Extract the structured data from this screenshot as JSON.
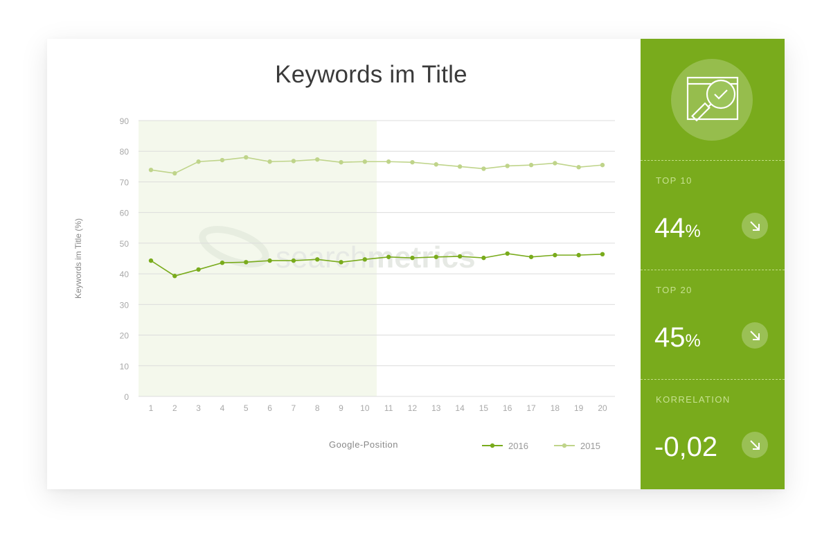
{
  "panel": {
    "brand_watermark": "searchmetrics",
    "icon": "magnifier-check-icon",
    "trend_icon": "arrow-down-right-icon",
    "accent_color": "#79ab1c",
    "stats": [
      {
        "label": "TOP 10",
        "value": "44",
        "unit": "%"
      },
      {
        "label": "TOP 20",
        "value": "45",
        "unit": "%"
      },
      {
        "label": "KORRELATION",
        "value": "-0,02",
        "unit": ""
      }
    ]
  },
  "chart_data": {
    "type": "line",
    "title": "Keywords im Title",
    "xlabel": "Google-Position",
    "ylabel": "Keywords im Title (%)",
    "x": [
      1,
      2,
      3,
      4,
      5,
      6,
      7,
      8,
      9,
      10,
      11,
      12,
      13,
      14,
      15,
      16,
      17,
      18,
      19,
      20
    ],
    "x_tick_labels": [
      "1",
      "2",
      "3",
      "4",
      "5",
      "6",
      "7",
      "8",
      "9",
      "10",
      "11",
      "12",
      "13",
      "14",
      "15",
      "16",
      "17",
      "18",
      "19",
      "20"
    ],
    "ylim": [
      0,
      90
    ],
    "y_ticks": [
      0,
      10,
      20,
      30,
      40,
      50,
      60,
      70,
      80,
      90
    ],
    "grid": true,
    "highlight_range": [
      1,
      10
    ],
    "legend_position": "bottom-right",
    "series": [
      {
        "name": "2016",
        "color": "#79ab1c",
        "values": [
          44.3,
          39.3,
          41.4,
          43.6,
          43.8,
          44.3,
          44.3,
          44.7,
          43.8,
          44.7,
          45.5,
          45.2,
          45.5,
          45.7,
          45.2,
          46.6,
          45.5,
          46.1,
          46.1,
          46.4
        ]
      },
      {
        "name": "2015",
        "color": "#bfd48a",
        "values": [
          73.9,
          72.8,
          76.6,
          77.1,
          78.0,
          76.6,
          76.8,
          77.3,
          76.4,
          76.6,
          76.6,
          76.4,
          75.7,
          75.0,
          74.3,
          75.2,
          75.5,
          76.1,
          74.8,
          75.5
        ]
      }
    ]
  }
}
